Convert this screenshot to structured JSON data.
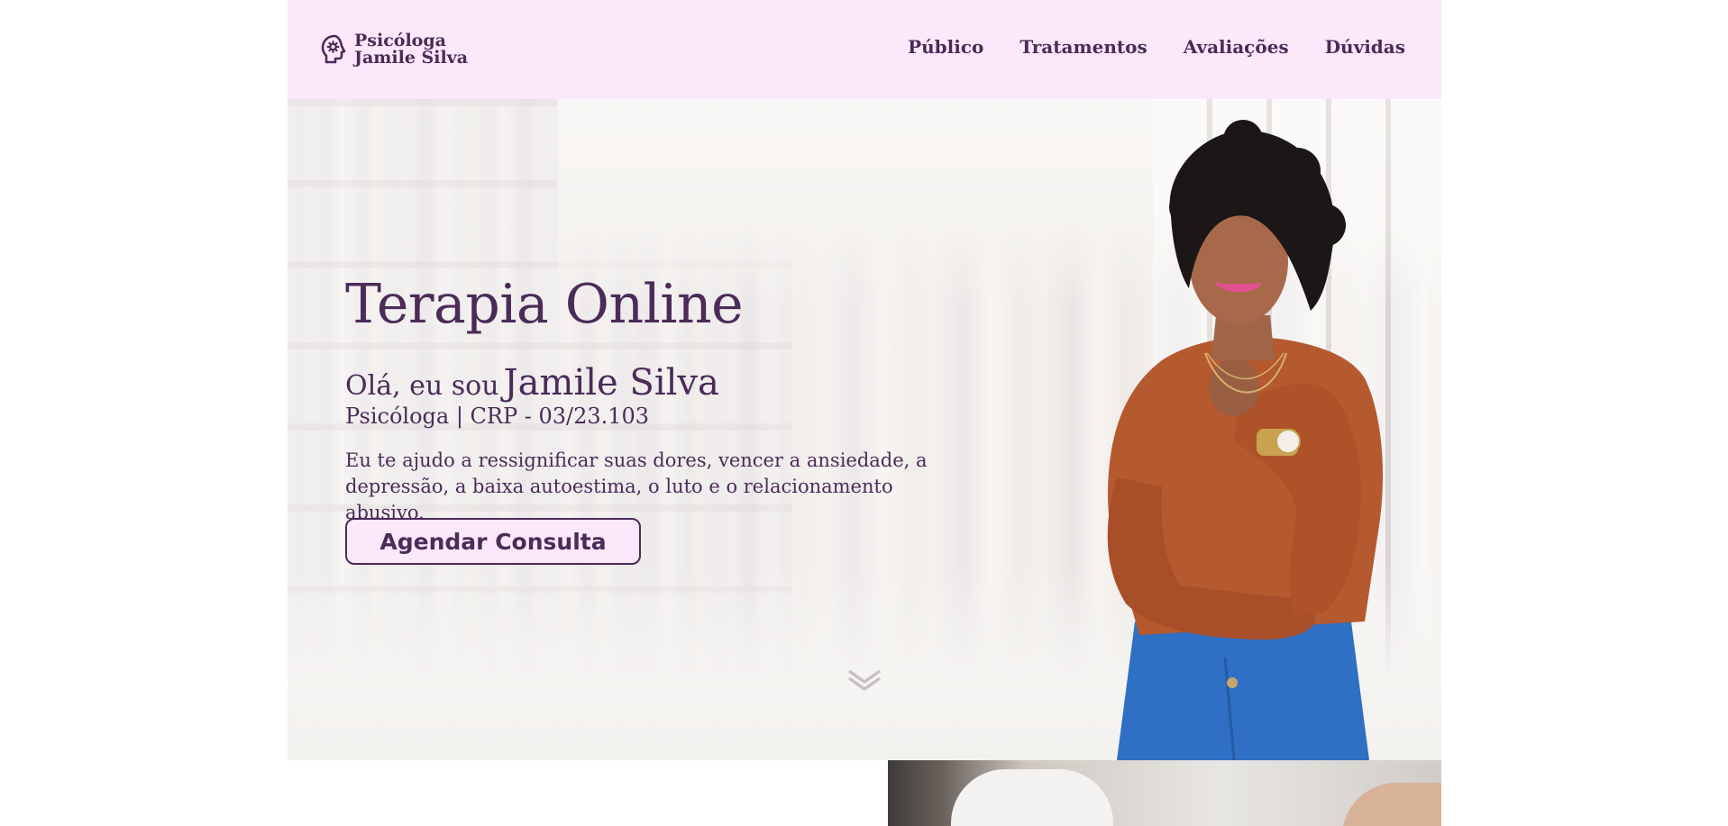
{
  "brand": {
    "line1": "Psicóloga",
    "line2": "Jamile Silva",
    "icon": "head-gear-icon"
  },
  "nav": {
    "items": [
      {
        "label": "Público"
      },
      {
        "label": "Tratamentos"
      },
      {
        "label": "Avaliações"
      },
      {
        "label": "Dúvidas"
      }
    ]
  },
  "hero": {
    "title": "Terapia Online",
    "greeting_prefix": "Olá, eu sou",
    "name": "Jamile Silva",
    "crp": "Psicóloga | CRP - 03/23.103",
    "description": "Eu te ajudo a ressignificar suas dores, vencer a ansiedade, a depressão, a baixa autoestima, o luto e o relacionamento abusivo.",
    "cta_label": "Agendar Consulta",
    "scroll_icon": "double-chevron-down-icon"
  },
  "colors": {
    "accent": "#4b2b58",
    "header_bg": "#fbe8fb",
    "button_bg": "#fbe8fb"
  }
}
